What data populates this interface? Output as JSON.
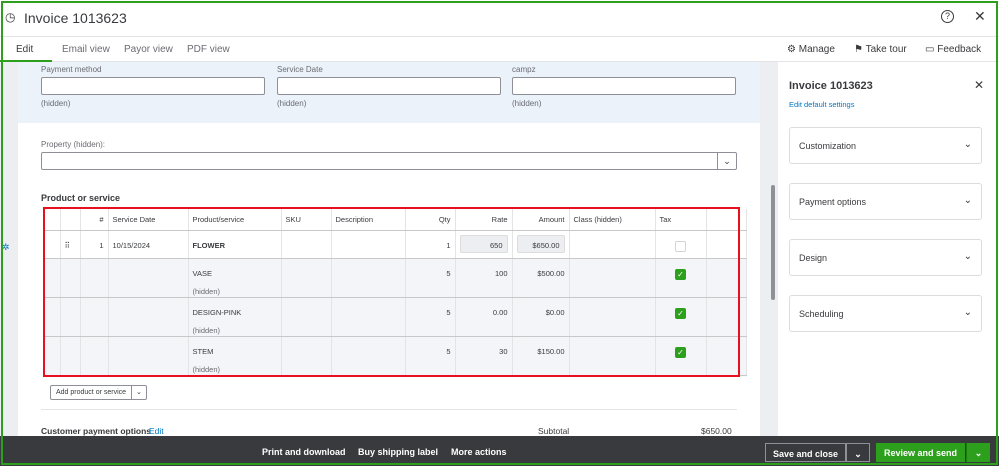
{
  "header": {
    "title": "Invoice 1013623"
  },
  "tabs": [
    "Edit",
    "Email view",
    "Payor view",
    "PDF view"
  ],
  "tools": {
    "manage": "Manage",
    "tour": "Take tour",
    "feedback": "Feedback"
  },
  "form": {
    "payment_method": "Payment method",
    "service_date": "Service Date",
    "campz": "campz",
    "hidden": "(hidden)",
    "property": "Property (hidden):",
    "section": "Product or service"
  },
  "table": {
    "headers": [
      "#",
      "Service Date",
      "Product/service",
      "SKU",
      "Description",
      "Qty",
      "Rate",
      "Amount",
      "Class (hidden)",
      "Tax"
    ],
    "rows": [
      {
        "n": "1",
        "date": "10/15/2024",
        "product": "FLOWER",
        "qty": "1",
        "rate": "650",
        "amount": "$650.00",
        "tax": false
      },
      {
        "n": "",
        "date": "",
        "product": "VASE",
        "sub": "(hidden)",
        "qty": "5",
        "rate": "100",
        "amount": "$500.00",
        "tax": true
      },
      {
        "n": "",
        "date": "",
        "product": "DESIGN-PINK",
        "sub": "(hidden)",
        "qty": "5",
        "rate": "0.00",
        "amount": "$0.00",
        "tax": true
      },
      {
        "n": "",
        "date": "",
        "product": "STEM",
        "sub": "(hidden)",
        "qty": "5",
        "rate": "30",
        "amount": "$150.00",
        "tax": true
      }
    ]
  },
  "add_button": "Add product or service",
  "payment_options": "Customer payment options",
  "edit": "Edit",
  "subtotal_label": "Subtotal",
  "subtotal": "$650.00",
  "panel": {
    "title": "Invoice 1013623",
    "link": "Edit default settings",
    "sections": [
      "Customization",
      "Payment options",
      "Design",
      "Scheduling"
    ]
  },
  "bottom": {
    "print": "Print and download",
    "shipping": "Buy shipping label",
    "more": "More actions",
    "save": "Save and close",
    "send": "Review and send"
  }
}
